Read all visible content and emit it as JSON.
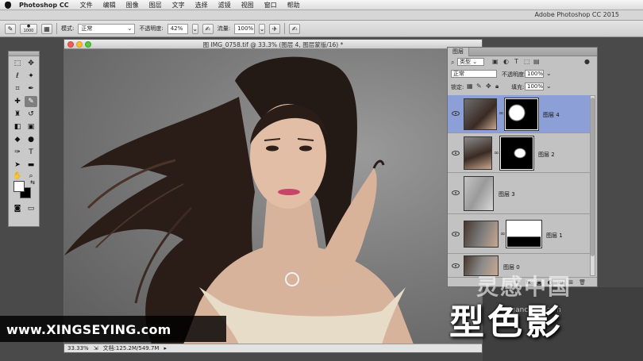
{
  "menubar": {
    "app_name": "Photoshop CC",
    "items": [
      "文件",
      "编辑",
      "图像",
      "图层",
      "文字",
      "选择",
      "滤镜",
      "视图",
      "窗口",
      "帮助"
    ]
  },
  "app_title": "Adobe Photoshop CC 2015",
  "options_bar": {
    "brush_size": "1000",
    "mode_label": "模式:",
    "mode_value": "正常",
    "opacity_label": "不透明度:",
    "opacity_value": "42%",
    "flow_label": "流量:",
    "flow_value": "100%"
  },
  "document": {
    "title": "图 IMG_0758.tif @ 33.3% (图层 4, 图层蒙版/16) *",
    "zoom": "33.33%",
    "doc_info": "文档:125.2M/549.7M"
  },
  "layers_panel": {
    "tab": "图层",
    "filter_kind": "类型",
    "blend_mode": "正常",
    "opacity_label": "不透明度:",
    "opacity_value": "100%",
    "lock_label": "锁定:",
    "fill_label": "填充:",
    "fill_value": "100%",
    "layers": [
      {
        "name": "图层 4",
        "selected": true
      },
      {
        "name": "图层 2",
        "selected": false
      },
      {
        "name": "图层 3",
        "selected": false
      },
      {
        "name": "图层 1",
        "selected": false
      },
      {
        "name": "图层 0",
        "selected": false
      }
    ],
    "footer_icons": [
      "link-icon",
      "fx-icon",
      "mask-icon",
      "adjustment-icon",
      "group-icon",
      "new-layer-icon",
      "trash-icon"
    ]
  },
  "watermarks": {
    "site": "www.XINGSEYING.com",
    "brand": "型色影",
    "logo_mark": "灵感中国",
    "logo_url": "lingganchina.com"
  },
  "colors": {
    "selection": "#8c9fd6",
    "foreground": "#ffffff",
    "background": "#000000"
  }
}
